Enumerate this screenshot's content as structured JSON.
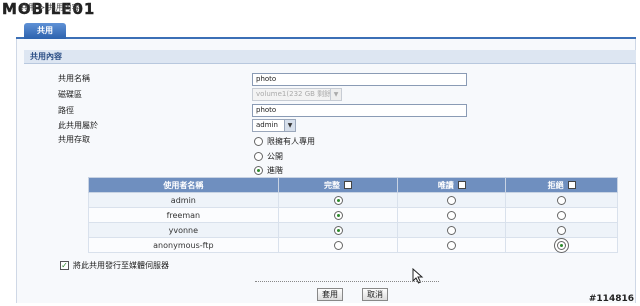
{
  "watermark": {
    "logo_text": "MOBILE01",
    "id_text": "#114816"
  },
  "breadcrumb": "共用 > 共用內容",
  "tabs": [
    {
      "label": "共用"
    }
  ],
  "section": {
    "title": "共用內容"
  },
  "form": {
    "share_name_label": "共用名稱",
    "share_name_value": "photo",
    "volume_label": "磁碟區",
    "volume_value": "volume1(232 GB 剩餘)",
    "path_label": "路徑",
    "path_value": "photo",
    "owner_label": "此共用屬於",
    "owner_value": "admin",
    "access_label": "共用存取",
    "access_options": [
      {
        "label": "限擁有人專用",
        "selected": false
      },
      {
        "label": "公開",
        "selected": false
      },
      {
        "label": "進階",
        "selected": true
      }
    ]
  },
  "permissions": {
    "headers": {
      "user": "使用者名稱",
      "full": "完整",
      "read": "唯讀",
      "deny": "拒絕"
    },
    "rows": [
      {
        "user": "admin",
        "selected": "full"
      },
      {
        "user": "freeman",
        "selected": "full"
      },
      {
        "user": "yvonne",
        "selected": "full"
      },
      {
        "user": "anonymous-ftp",
        "selected": "deny"
      }
    ]
  },
  "publish": {
    "label": "將此共用發行至媒體伺服器",
    "checked": true
  },
  "buttons": {
    "apply": "套用",
    "cancel": "取消"
  },
  "colors": {
    "tab": "#2c62ad",
    "table_header": "#6f8fbf",
    "section_header": "#dde6f2"
  }
}
